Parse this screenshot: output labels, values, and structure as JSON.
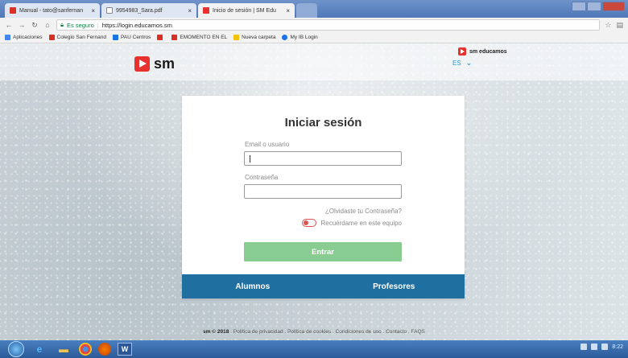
{
  "browser": {
    "tabs": [
      {
        "label": "Manual - tato@sanfernan",
        "icon": "gmail-icon",
        "color": "#d93025",
        "active": false
      },
      {
        "label": "9954983_Sara.pdf",
        "icon": "document-icon",
        "color": "#5f6368",
        "active": false
      },
      {
        "label": "Inicio de sesión | SM Edu",
        "icon": "sm-favicon-icon",
        "color": "#e8312f",
        "active": true
      }
    ],
    "address": {
      "security_label": "Es seguro",
      "url": "https://login.educamos.sm"
    },
    "bookmarks": [
      {
        "label": "Aplicaciones",
        "color": "#4285f4"
      },
      {
        "label": "Colegio San Fernand",
        "color": "#d93025"
      },
      {
        "label": "PAU Centros",
        "color": "#1a73e8"
      },
      {
        "label": "",
        "color": "#d93025"
      },
      {
        "label": "EMOMENTO EN EL",
        "color": "#d93025"
      },
      {
        "label": "Nueva carpeta",
        "color": "#f4c20d"
      },
      {
        "label": "My IB Login",
        "color": "#1a73e8"
      }
    ]
  },
  "header": {
    "logo_text": "sm",
    "language": "ES"
  },
  "login": {
    "title": "Iniciar sesión",
    "email_label": "Email o usuario",
    "email_value": "",
    "password_label": "Contraseña",
    "password_value": "",
    "forgot_link": "¿Olvidaste tu Contraseña?",
    "remember_label": "Recuérdame en este equipo",
    "submit_label": "Entrar",
    "roles": [
      "Alumnos",
      "Profesores"
    ]
  },
  "footer": {
    "copyright": "sm © 2018",
    "links": "Política de privacidad . Política de cookies . Condiciones de uso . Contacto . FAQS",
    "brand": "sm educamos"
  },
  "taskbar": {
    "clock": "8:22"
  },
  "colors": {
    "brand_red": "#e8312f",
    "accent_blue": "#1f6fa0",
    "submit_green": "#89cc91"
  }
}
